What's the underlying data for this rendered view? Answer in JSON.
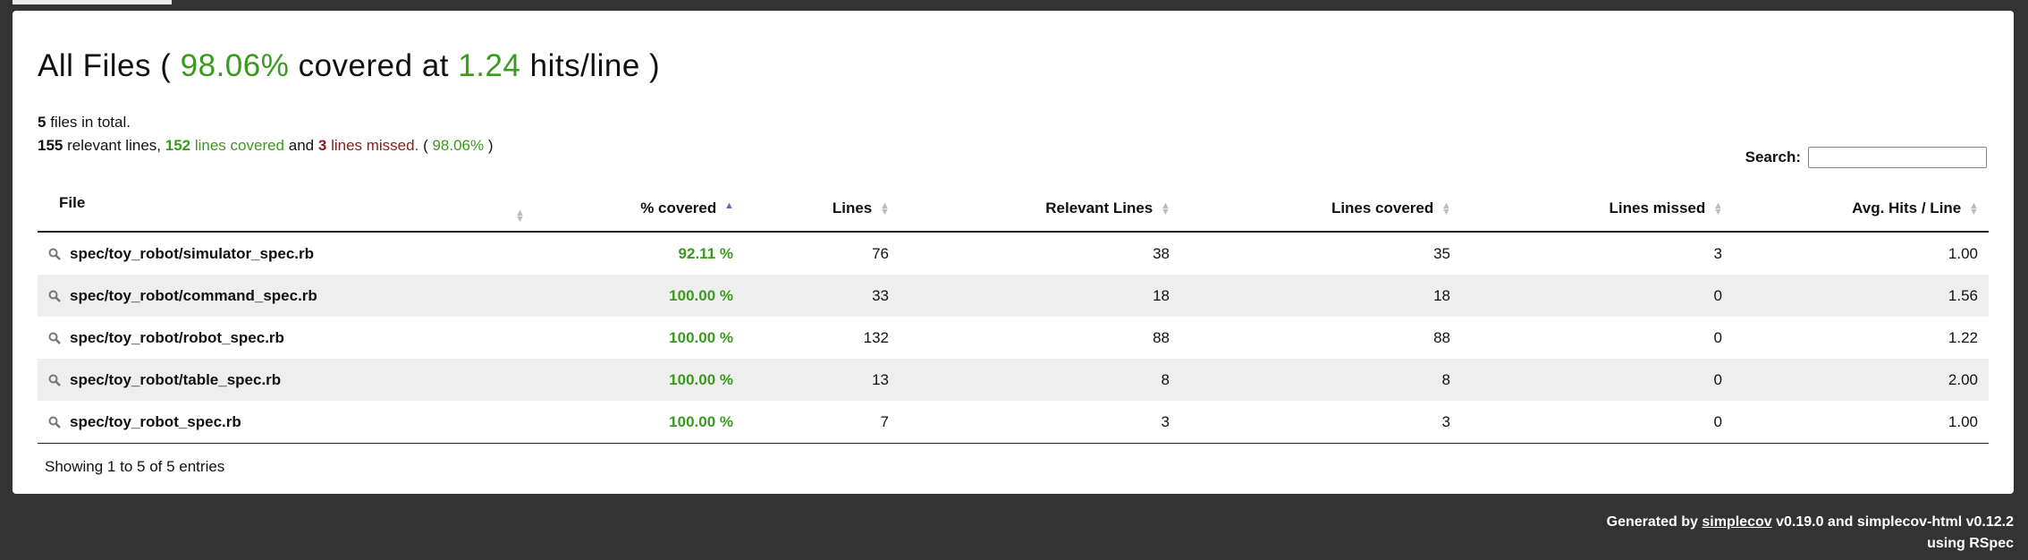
{
  "header": {
    "title_prefix": "All Files (",
    "covered_percent": "98.06%",
    "title_mid": "covered at",
    "hits_per_line": "1.24",
    "title_suffix": "hits/line )"
  },
  "summary": {
    "files_count": "5",
    "files_text": "files in total.",
    "relevant_lines": "155",
    "relevant_text": "relevant lines,",
    "lines_covered": "152",
    "covered_text": "lines covered",
    "and_text": "and",
    "lines_missed": "3",
    "missed_text": "lines missed.",
    "paren_open": "(",
    "percent": "98.06%",
    "paren_close": ")"
  },
  "search": {
    "label": "Search:",
    "value": ""
  },
  "table": {
    "columns": [
      "File",
      "% covered",
      "Lines",
      "Relevant Lines",
      "Lines covered",
      "Lines missed",
      "Avg. Hits / Line"
    ],
    "rows": [
      {
        "file": "spec/toy_robot/simulator_spec.rb",
        "covered": "92.11 %",
        "lines": "76",
        "relevant": "38",
        "covered_lines": "35",
        "missed": "3",
        "avg_hits": "1.00"
      },
      {
        "file": "spec/toy_robot/command_spec.rb",
        "covered": "100.00 %",
        "lines": "33",
        "relevant": "18",
        "covered_lines": "18",
        "missed": "0",
        "avg_hits": "1.56"
      },
      {
        "file": "spec/toy_robot/robot_spec.rb",
        "covered": "100.00 %",
        "lines": "132",
        "relevant": "88",
        "covered_lines": "88",
        "missed": "0",
        "avg_hits": "1.22"
      },
      {
        "file": "spec/toy_robot/table_spec.rb",
        "covered": "100.00 %",
        "lines": "13",
        "relevant": "8",
        "covered_lines": "8",
        "missed": "0",
        "avg_hits": "2.00"
      },
      {
        "file": "spec/toy_robot_spec.rb",
        "covered": "100.00 %",
        "lines": "7",
        "relevant": "3",
        "covered_lines": "3",
        "missed": "0",
        "avg_hits": "1.00"
      }
    ]
  },
  "pagination": {
    "showing": "Showing 1 to 5 of 5 entries"
  },
  "footer": {
    "generated_by": "Generated by",
    "simplecov_link": "simplecov",
    "version_text": "v0.19.0 and simplecov-html v0.12.2",
    "using_text": "using RSpec"
  },
  "colors": {
    "covered": "#3a9a1e",
    "missed": "#8b1a1a",
    "background": "#333333",
    "panel": "#ffffff",
    "stripe": "#eeeeee"
  },
  "icons": {
    "row_icon": "magnifier-icon",
    "sort_icon": "sort-arrows-icon"
  }
}
